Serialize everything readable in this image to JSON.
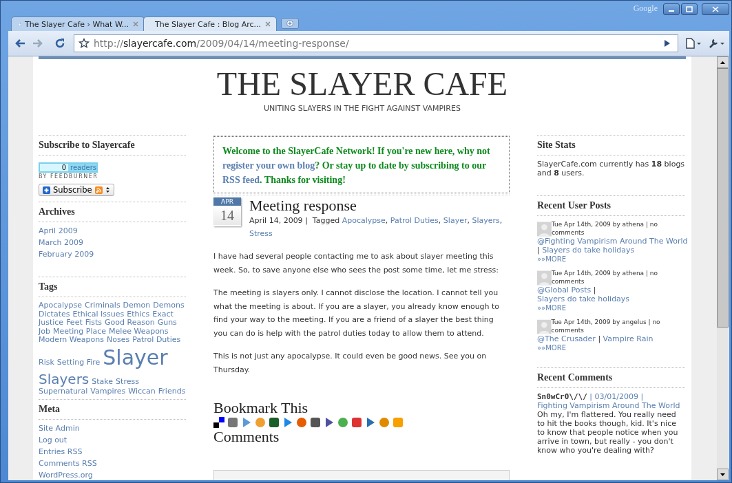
{
  "window": {
    "brand": "Google"
  },
  "tabs": [
    {
      "title": "The Slayer Cafe › What W...",
      "selected": false
    },
    {
      "title": "The Slayer Cafe : Blog Arc...",
      "selected": true
    }
  ],
  "address_bar": {
    "scheme": "http://",
    "host": "slayercafe.com",
    "path": "/2009/04/14/meeting-response/"
  },
  "site": {
    "title": "THE SLAYER CAFE",
    "tagline": "UNITING SLAYERS IN THE FIGHT AGAINST VAMPIRES"
  },
  "left_sidebar": {
    "subscribe": {
      "heading": "Subscribe to Slayercafe",
      "reader_count": "0",
      "reader_label": "readers",
      "byline": "BY FEEDBURNER",
      "button": "Subscribe"
    },
    "archives": {
      "heading": "Archives",
      "items": [
        "April 2009",
        "March 2009",
        "February 2009"
      ]
    },
    "tags": {
      "heading": "Tags",
      "items": [
        {
          "label": "Apocalypse",
          "kind": "small"
        },
        {
          "label": "Criminals",
          "kind": "small"
        },
        {
          "label": "Demon",
          "kind": "small"
        },
        {
          "label": "Demons",
          "kind": "small"
        },
        {
          "label": "Dictates",
          "kind": "small"
        },
        {
          "label": "Ethical Issues",
          "kind": "small"
        },
        {
          "label": "Ethics",
          "kind": "small"
        },
        {
          "label": "Exact",
          "kind": "small"
        },
        {
          "label": "Justice",
          "kind": "small"
        },
        {
          "label": "Feet",
          "kind": "small"
        },
        {
          "label": "Fists",
          "kind": "small"
        },
        {
          "label": "Good Reason",
          "kind": "small"
        },
        {
          "label": "Guns",
          "kind": "small"
        },
        {
          "label": "Job",
          "kind": "small"
        },
        {
          "label": "Meeting Place",
          "kind": "small"
        },
        {
          "label": "Melee Weapons",
          "kind": "small"
        },
        {
          "label": "Modern Weapons",
          "kind": "small"
        },
        {
          "label": "Noses",
          "kind": "small"
        },
        {
          "label": "Patrol Duties",
          "kind": "small"
        },
        {
          "label": "Risk",
          "kind": "small"
        },
        {
          "label": "Setting Fire",
          "kind": "small"
        },
        {
          "label": "Slayer",
          "kind": "largest"
        },
        {
          "label": "Slayers",
          "kind": "large"
        },
        {
          "label": "Stake",
          "kind": "small"
        },
        {
          "label": "Stress",
          "kind": "small"
        },
        {
          "label": "Supernatural",
          "kind": "small"
        },
        {
          "label": "Vampires",
          "kind": "small"
        },
        {
          "label": "Wiccan",
          "kind": "small"
        },
        {
          "label": "Friends",
          "kind": "small"
        }
      ]
    },
    "meta": {
      "heading": "Meta",
      "items": [
        "Site Admin",
        "Log out",
        "Entries RSS",
        "Comments RSS",
        "WordPress.org"
      ]
    }
  },
  "welcome": [
    {
      "text": "Welcome to the SlayerCafe Network! If you're new here, why not ",
      "kind": "text"
    },
    {
      "text": "register your own blog",
      "kind": "link"
    },
    {
      "text": "? Or stay up to date by subscribing to our ",
      "kind": "text"
    },
    {
      "text": "RSS feed",
      "kind": "link"
    },
    {
      "text": ". Thanks for visiting!",
      "kind": "text"
    }
  ],
  "post": {
    "month": "APR",
    "day": "14",
    "title": "Meeting response",
    "date": "April 14, 2009",
    "separator": "|",
    "tag_separator": ",",
    "tagged_label": "Tagged",
    "tags": [
      "Apocalypse",
      "Patrol Duties",
      "Slayer",
      "Slayers",
      "Stress"
    ],
    "paragraphs": [
      "I have had several people contacting me to ask about slayer meeting this week. So, to save anyone else who sees the post some time, let me stress:",
      "The meeting is slayers only. I cannot disclose the location. I cannot tell you what the meeting is about. If you are a slayer, you already know enough to find your way to the meeting. If you are a friend of a slayer the best thing you can do is help with the patrol duties today to allow them to attend.",
      "This is not just any apocalypse. It could even be good news. See you on Thursday."
    ],
    "bookmark_heading": "Bookmark This",
    "comments_heading": "Comments"
  },
  "right_sidebar": {
    "site_stats": {
      "heading": "Site Stats",
      "text": "SlayerCafe.com currently has **18** blogs and **8** users."
    },
    "recent_user_posts": {
      "heading": "Recent User Posts",
      "items": [
        {
          "meta": "Tue Apr 14th, 2009 by athena | no comments",
          "blog": "@Fighting Vampirism Around The World",
          "separator": "|",
          "post": "Slayers do take holidays",
          "more": "»»MORE"
        },
        {
          "meta": "Tue Apr 14th, 2009 by athena | no comments",
          "blog": "@Global Posts",
          "separator": "|",
          "post": "Slayers do take holidays",
          "more": "»»MORE"
        },
        {
          "meta": "Tue Apr 14th, 2009 by angelus | no comments",
          "blog": "@The Crusader",
          "separator": "|",
          "post": "Vampire Rain",
          "more": "»»MORE"
        }
      ]
    },
    "recent_comments": {
      "heading": "Recent Comments",
      "items": [
        {
          "author": "Sn0wCr0\\/\\/",
          "date": "| 03/01/2009 |",
          "post": "Fighting Vampirism Around The World",
          "text": "Oh my, I'm flattered. You really need to hit the books though, kid. It's nice to know that people notice when you arrive in town, but really - you don't know who you're dealing with?"
        }
      ]
    }
  }
}
